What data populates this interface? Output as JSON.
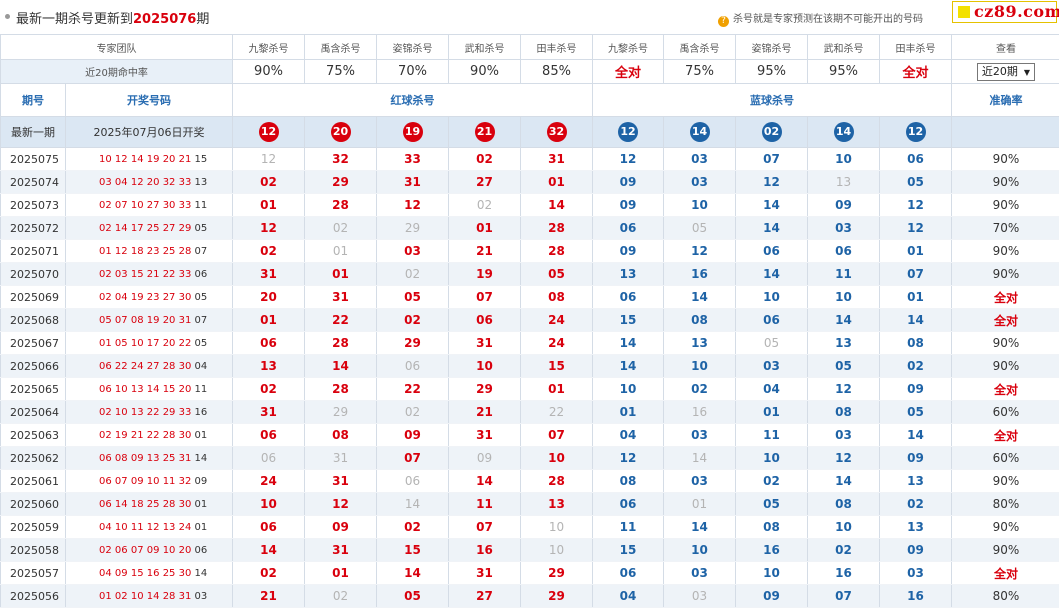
{
  "header": {
    "title_prefix": "最新一期杀号更新到",
    "title_period": "2025076",
    "title_suffix": "期",
    "hint_icon": "question-icon",
    "hint": "杀号就是专家预测在该期不可能开出的号码",
    "logo": "cz89.com"
  },
  "experts_label": "专家团队",
  "experts": [
    "九黎杀号",
    "禹含杀号",
    "姿锦杀号",
    "武和杀号",
    "田丰杀号",
    "九黎杀号",
    "禹含杀号",
    "姿锦杀号",
    "武和杀号",
    "田丰杀号"
  ],
  "view_label": "查看",
  "rate_label": "近20期命中率",
  "rates": [
    "90%",
    "75%",
    "70%",
    "90%",
    "85%",
    "全对",
    "75%",
    "95%",
    "95%",
    "全对"
  ],
  "period_select": {
    "value": "近20期"
  },
  "columns": {
    "period": "期号",
    "draw": "开奖号码",
    "red": "红球杀号",
    "blue": "蓝球杀号",
    "accuracy": "准确率"
  },
  "latest": {
    "label": "最新一期",
    "date": "2025年07月06日开奖",
    "red": [
      "12",
      "20",
      "19",
      "21",
      "32"
    ],
    "blue": [
      "12",
      "14",
      "02",
      "14",
      "12"
    ]
  },
  "colors": {
    "red": "#d9000d",
    "blue": "#1e63a6",
    "miss": "#b4b4b4",
    "header_blue": "#2a6db2",
    "row_alt": "#eef3f8"
  },
  "rows": [
    {
      "period": "2025075",
      "red_draw": [
        "10",
        "12",
        "14",
        "19",
        "20",
        "21"
      ],
      "blue_draw": "15",
      "red_kill": [
        "12",
        "32",
        "33",
        "02",
        "31"
      ],
      "blue_kill": [
        "12",
        "03",
        "07",
        "10",
        "06"
      ],
      "red_miss": [
        0
      ],
      "blue_miss": [],
      "accuracy": "90%"
    },
    {
      "period": "2025074",
      "red_draw": [
        "03",
        "04",
        "12",
        "20",
        "32",
        "33"
      ],
      "blue_draw": "13",
      "red_kill": [
        "02",
        "29",
        "31",
        "27",
        "01"
      ],
      "blue_kill": [
        "09",
        "03",
        "12",
        "13",
        "05"
      ],
      "red_miss": [],
      "blue_miss": [
        3
      ],
      "accuracy": "90%"
    },
    {
      "period": "2025073",
      "red_draw": [
        "02",
        "07",
        "10",
        "27",
        "30",
        "33"
      ],
      "blue_draw": "11",
      "red_kill": [
        "01",
        "28",
        "12",
        "02",
        "14"
      ],
      "blue_kill": [
        "09",
        "10",
        "14",
        "09",
        "12"
      ],
      "red_miss": [
        3
      ],
      "blue_miss": [],
      "accuracy": "90%"
    },
    {
      "period": "2025072",
      "red_draw": [
        "02",
        "14",
        "17",
        "25",
        "27",
        "29"
      ],
      "blue_draw": "05",
      "red_kill": [
        "12",
        "02",
        "29",
        "01",
        "28"
      ],
      "blue_kill": [
        "06",
        "05",
        "14",
        "03",
        "12"
      ],
      "red_miss": [
        1,
        2
      ],
      "blue_miss": [
        1
      ],
      "accuracy": "70%"
    },
    {
      "period": "2025071",
      "red_draw": [
        "01",
        "12",
        "18",
        "23",
        "25",
        "28"
      ],
      "blue_draw": "07",
      "red_kill": [
        "02",
        "01",
        "03",
        "21",
        "28"
      ],
      "blue_kill": [
        "09",
        "12",
        "06",
        "06",
        "01"
      ],
      "red_miss": [
        1
      ],
      "blue_miss": [],
      "accuracy": "90%"
    },
    {
      "period": "2025070",
      "red_draw": [
        "02",
        "03",
        "15",
        "21",
        "22",
        "33"
      ],
      "blue_draw": "06",
      "red_kill": [
        "31",
        "01",
        "02",
        "19",
        "05"
      ],
      "blue_kill": [
        "13",
        "16",
        "14",
        "11",
        "07"
      ],
      "red_miss": [
        2
      ],
      "blue_miss": [],
      "accuracy": "90%"
    },
    {
      "period": "2025069",
      "red_draw": [
        "02",
        "04",
        "19",
        "23",
        "27",
        "30"
      ],
      "blue_draw": "05",
      "red_kill": [
        "20",
        "31",
        "05",
        "07",
        "08"
      ],
      "blue_kill": [
        "06",
        "14",
        "10",
        "10",
        "01"
      ],
      "red_miss": [],
      "blue_miss": [],
      "accuracy": "全对"
    },
    {
      "period": "2025068",
      "red_draw": [
        "05",
        "07",
        "08",
        "19",
        "20",
        "31"
      ],
      "blue_draw": "07",
      "red_kill": [
        "01",
        "22",
        "02",
        "06",
        "24"
      ],
      "blue_kill": [
        "15",
        "08",
        "06",
        "14",
        "14"
      ],
      "red_miss": [],
      "blue_miss": [],
      "accuracy": "全对"
    },
    {
      "period": "2025067",
      "red_draw": [
        "01",
        "05",
        "10",
        "17",
        "20",
        "22"
      ],
      "blue_draw": "05",
      "red_kill": [
        "06",
        "28",
        "29",
        "31",
        "24"
      ],
      "blue_kill": [
        "14",
        "13",
        "05",
        "13",
        "08"
      ],
      "red_miss": [],
      "blue_miss": [
        2
      ],
      "accuracy": "90%"
    },
    {
      "period": "2025066",
      "red_draw": [
        "06",
        "22",
        "24",
        "27",
        "28",
        "30"
      ],
      "blue_draw": "04",
      "red_kill": [
        "13",
        "14",
        "06",
        "10",
        "15"
      ],
      "blue_kill": [
        "14",
        "10",
        "03",
        "05",
        "02"
      ],
      "red_miss": [
        2
      ],
      "blue_miss": [],
      "accuracy": "90%"
    },
    {
      "period": "2025065",
      "red_draw": [
        "06",
        "10",
        "13",
        "14",
        "15",
        "20"
      ],
      "blue_draw": "11",
      "red_kill": [
        "02",
        "28",
        "22",
        "29",
        "01"
      ],
      "blue_kill": [
        "10",
        "02",
        "04",
        "12",
        "09"
      ],
      "red_miss": [],
      "blue_miss": [],
      "accuracy": "全对"
    },
    {
      "period": "2025064",
      "red_draw": [
        "02",
        "10",
        "13",
        "22",
        "29",
        "33"
      ],
      "blue_draw": "16",
      "red_kill": [
        "31",
        "29",
        "02",
        "21",
        "22"
      ],
      "blue_kill": [
        "01",
        "16",
        "01",
        "08",
        "05"
      ],
      "red_miss": [
        1,
        2,
        4
      ],
      "blue_miss": [
        1
      ],
      "accuracy": "60%"
    },
    {
      "period": "2025063",
      "red_draw": [
        "02",
        "19",
        "21",
        "22",
        "28",
        "30"
      ],
      "blue_draw": "01",
      "red_kill": [
        "06",
        "08",
        "09",
        "31",
        "07"
      ],
      "blue_kill": [
        "04",
        "03",
        "11",
        "03",
        "14"
      ],
      "red_miss": [],
      "blue_miss": [],
      "accuracy": "全对"
    },
    {
      "period": "2025062",
      "red_draw": [
        "06",
        "08",
        "09",
        "13",
        "25",
        "31"
      ],
      "blue_draw": "14",
      "red_kill": [
        "06",
        "31",
        "07",
        "09",
        "10"
      ],
      "blue_kill": [
        "12",
        "14",
        "10",
        "12",
        "09"
      ],
      "red_miss": [
        0,
        1,
        3
      ],
      "blue_miss": [
        1
      ],
      "accuracy": "60%"
    },
    {
      "period": "2025061",
      "red_draw": [
        "06",
        "07",
        "09",
        "10",
        "11",
        "32"
      ],
      "blue_draw": "09",
      "red_kill": [
        "24",
        "31",
        "06",
        "14",
        "28"
      ],
      "blue_kill": [
        "08",
        "03",
        "02",
        "14",
        "13"
      ],
      "red_miss": [
        2
      ],
      "blue_miss": [],
      "accuracy": "90%"
    },
    {
      "period": "2025060",
      "red_draw": [
        "06",
        "14",
        "18",
        "25",
        "28",
        "30"
      ],
      "blue_draw": "01",
      "red_kill": [
        "10",
        "12",
        "14",
        "11",
        "13"
      ],
      "blue_kill": [
        "06",
        "01",
        "05",
        "08",
        "02"
      ],
      "red_miss": [
        2
      ],
      "blue_miss": [
        1
      ],
      "accuracy": "80%"
    },
    {
      "period": "2025059",
      "red_draw": [
        "04",
        "10",
        "11",
        "12",
        "13",
        "24"
      ],
      "blue_draw": "01",
      "red_kill": [
        "06",
        "09",
        "02",
        "07",
        "10"
      ],
      "blue_kill": [
        "11",
        "14",
        "08",
        "10",
        "13"
      ],
      "red_miss": [
        4
      ],
      "blue_miss": [],
      "accuracy": "90%"
    },
    {
      "period": "2025058",
      "red_draw": [
        "02",
        "06",
        "07",
        "09",
        "10",
        "20"
      ],
      "blue_draw": "06",
      "red_kill": [
        "14",
        "31",
        "15",
        "16",
        "10"
      ],
      "blue_kill": [
        "15",
        "10",
        "16",
        "02",
        "09"
      ],
      "red_miss": [
        4
      ],
      "blue_miss": [],
      "accuracy": "90%"
    },
    {
      "period": "2025057",
      "red_draw": [
        "04",
        "09",
        "15",
        "16",
        "25",
        "30"
      ],
      "blue_draw": "14",
      "red_kill": [
        "02",
        "01",
        "14",
        "31",
        "29"
      ],
      "blue_kill": [
        "06",
        "03",
        "10",
        "16",
        "03"
      ],
      "red_miss": [],
      "blue_miss": [],
      "accuracy": "全对"
    },
    {
      "period": "2025056",
      "red_draw": [
        "01",
        "02",
        "10",
        "14",
        "28",
        "31"
      ],
      "blue_draw": "03",
      "red_kill": [
        "21",
        "02",
        "05",
        "27",
        "29"
      ],
      "blue_kill": [
        "04",
        "03",
        "09",
        "07",
        "16"
      ],
      "red_miss": [
        1
      ],
      "blue_miss": [
        1
      ],
      "accuracy": "80%"
    }
  ]
}
